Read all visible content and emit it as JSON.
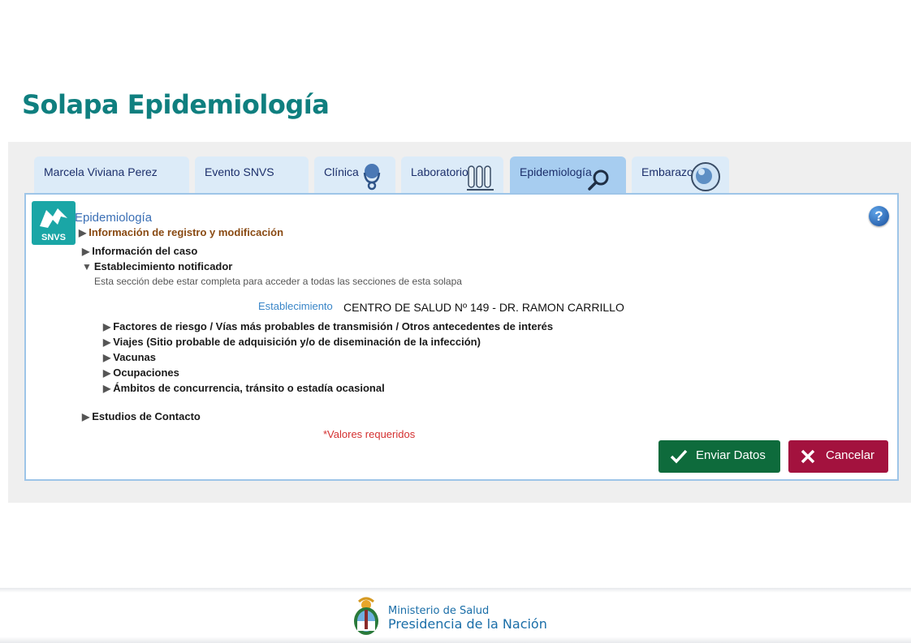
{
  "slide": {
    "title": "Solapa Epidemiología"
  },
  "tabs": [
    {
      "label": "Marcela Viviana Perez",
      "active": false
    },
    {
      "label": "Evento SNVS",
      "active": false
    },
    {
      "label": "Clínica",
      "active": false
    },
    {
      "label": "Laboratorio",
      "active": false
    },
    {
      "label": "Epidemiología",
      "active": true
    },
    {
      "label": "Embarazo",
      "active": false
    }
  ],
  "panel": {
    "logo_text": "SNVS",
    "section_title": "Epidemiología",
    "help_label": "?",
    "items": [
      {
        "label": "Información de registro y modificación",
        "expanded": false
      },
      {
        "label": "Información del caso",
        "expanded": false
      },
      {
        "label": "Establecimiento notificador",
        "expanded": true
      }
    ],
    "note": "Esta sección debe estar completa para acceder a todas las secciones de esta solapa",
    "establecimiento": {
      "label": "Establecimiento",
      "value": "CENTRO DE SALUD Nº 149 - DR. RAMON CARRILLO"
    },
    "subitems": [
      "Factores de riesgo / Vías más probables de transmisión / Otros antecedentes de interés",
      "Viajes (Sitio probable de adquisición y/o de diseminación de la infección)",
      "Vacunas",
      "Ocupaciones",
      "Ámbitos de concurrencia, tránsito o estadía ocasional"
    ],
    "contact_studies": "Estudios de Contacto",
    "required_note": "*Valores requeridos",
    "buttons": {
      "send": "Enviar Datos",
      "cancel": "Cancelar"
    }
  },
  "footer": {
    "line1": "Ministerio de Salud",
    "line2": "Presidencia de la Nación"
  },
  "colors": {
    "title": "#0f7f7f",
    "tab": "#dcebf8",
    "tab_active": "#a7cdf0",
    "send": "#0e6b3c",
    "cancel": "#a3123e"
  }
}
